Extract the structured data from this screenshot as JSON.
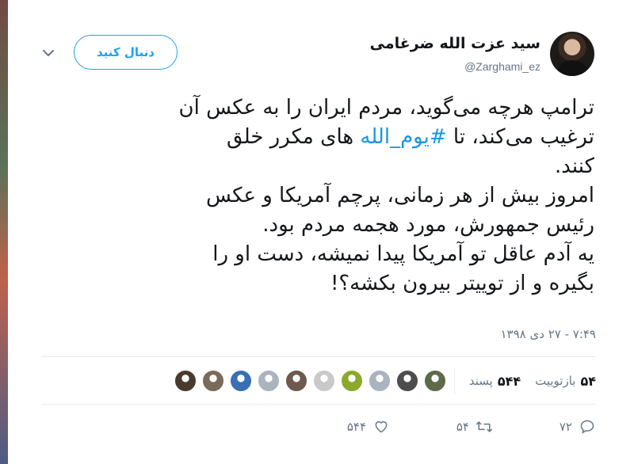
{
  "header": {
    "display_name": "سید عزت الله ضرغامی",
    "handle": "@Zarghami_ez",
    "follow_label": "دنبال کنید"
  },
  "tweet": {
    "line1": "ترامپ هرچه می‌گوید، مردم ایران را به عکس آن",
    "line2_pre": "ترغیب می‌کند، تا ",
    "hashtag": "#یوم_الله",
    "line2_post": " های مکرر خلق",
    "line3": "کنند.",
    "line4": " امروز بیش از هر زمانی، پرچم  آمریکا و عکس",
    "line5": "رئیس جمهورش، مورد هجمه مردم بود.",
    "line6": " یه آدم عاقل تو آمریکا پیدا نمیشه، دست او را",
    "line7": "بگیره و از توییتر بیرون بکشه؟!"
  },
  "timestamp": "۷:۴۹ - ۲۷ دی ۱۳۹۸",
  "stats": {
    "retweets_count": "۵۴",
    "retweets_label": "بازتوییت",
    "likes_count": "۵۴۴",
    "likes_label": "پسند"
  },
  "likers": [
    {
      "color": "#4a3a2e"
    },
    {
      "color": "#7a6a5a"
    },
    {
      "color": "#3a6fb5"
    },
    {
      "color": "#a9b4bf"
    },
    {
      "color": "#6d5a4d"
    },
    {
      "color": "#c9c9c9"
    },
    {
      "color": "#8da92b"
    },
    {
      "color": "#a9b4bf"
    },
    {
      "color": "#4d4d4d"
    },
    {
      "color": "#5e6b4a"
    }
  ],
  "actions": {
    "reply_count": "۷۲",
    "retweet_count": "۵۴",
    "like_count": "۵۴۴"
  },
  "colors": {
    "accent": "#1da1f2",
    "muted": "#657786",
    "hashtag": "#1b95e0"
  }
}
